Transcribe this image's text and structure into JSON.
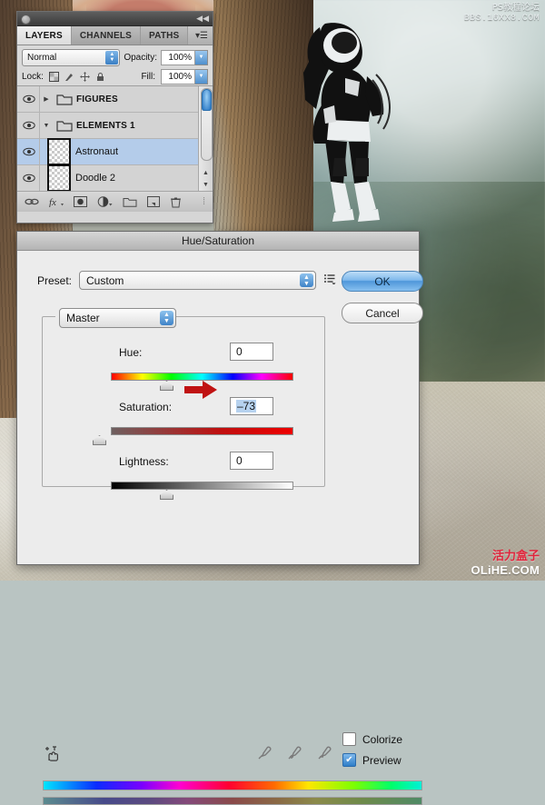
{
  "background": {
    "watermark_top": {
      "line1": "PS教程论坛",
      "line2": "BBS.16XX8.COM"
    },
    "watermark_bottom": {
      "line1": "活力盒子",
      "line2": "OLiHE.COM"
    },
    "artwork_name": "astronaut-photo-composite"
  },
  "layers_panel": {
    "tabs": [
      {
        "label": "LAYERS",
        "active": true
      },
      {
        "label": "CHANNELS",
        "active": false
      },
      {
        "label": "PATHS",
        "active": false
      }
    ],
    "panel_menu_icon": "panel-menu-icon",
    "blend_mode": "Normal",
    "opacity_label": "Opacity:",
    "opacity_value": "100%",
    "lock_label": "Lock:",
    "lock_icons": [
      "lock-transparency-icon",
      "lock-image-icon",
      "lock-position-icon",
      "lock-all-icon"
    ],
    "fill_label": "Fill:",
    "fill_value": "100%",
    "layers": [
      {
        "name": "FIGURES",
        "type": "group",
        "expanded": false,
        "selected": false,
        "visible": true
      },
      {
        "name": "ELEMENTS 1",
        "type": "group",
        "expanded": true,
        "selected": false,
        "visible": true
      },
      {
        "name": "Astronaut",
        "type": "layer",
        "selected": true,
        "visible": true
      },
      {
        "name": "Doodle 2",
        "type": "layer",
        "selected": false,
        "visible": true
      }
    ],
    "footer_icons": [
      "link-layers-icon",
      "layer-style-fx-icon",
      "layer-mask-icon",
      "adjustment-layer-icon",
      "new-group-icon",
      "new-layer-icon",
      "delete-layer-icon"
    ]
  },
  "dialog": {
    "title": "Hue/Saturation",
    "preset_label": "Preset:",
    "preset_value": "Custom",
    "preset_menu_icon": "preset-menu-icon",
    "ok_label": "OK",
    "cancel_label": "Cancel",
    "channel_value": "Master",
    "sliders": [
      {
        "label": "Hue:",
        "value": "0",
        "selected": false,
        "knob_pct": 50
      },
      {
        "label": "Saturation:",
        "value": "–73",
        "selected": true,
        "knob_pct": 13
      },
      {
        "label": "Lightness:",
        "value": "0",
        "selected": false,
        "knob_pct": 50
      }
    ],
    "eyedropper_icons": [
      "eyedropper-icon",
      "eyedropper-add-icon",
      "eyedropper-subtract-icon"
    ],
    "hand_icon": "target-adjustment-hand-icon",
    "colorize_label": "Colorize",
    "colorize_checked": false,
    "preview_label": "Preview",
    "preview_checked": true,
    "annotation_arrow": "red-arrow-marker",
    "accent_color": "#3f83c7",
    "selection_color": "#b6d2ef",
    "arrow_color": "#c01212"
  }
}
